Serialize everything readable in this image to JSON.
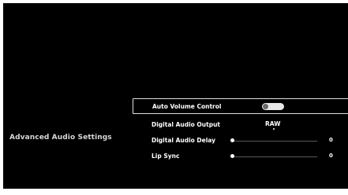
{
  "panel": {
    "title": "Advanced Audio Settings"
  },
  "settings": [
    {
      "label": "Auto Volume Control",
      "type": "toggle",
      "enabled": false
    },
    {
      "label": "Digital Audio Output",
      "type": "select",
      "value": "RAW"
    },
    {
      "label": "Digital Audio Delay",
      "type": "slider",
      "value": "0"
    },
    {
      "label": "Lip Sync",
      "type": "slider",
      "value": "0"
    }
  ],
  "colors": {
    "background": "#000000",
    "text": "#ffffff",
    "focus_border": "#e0e0e0",
    "toggle_off_track": "#e8e8e8"
  }
}
